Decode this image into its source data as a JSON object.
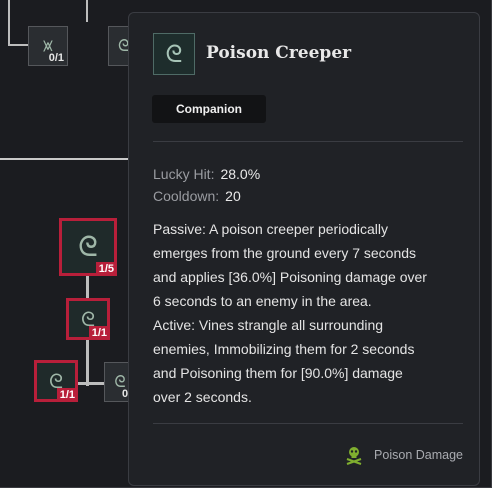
{
  "tooltip": {
    "title": "Poison Creeper",
    "icon": "vine-swirl-icon",
    "tag": "Companion",
    "stats": [
      {
        "label": "Lucky Hit:",
        "value": "28.0%"
      },
      {
        "label": "Cooldown:",
        "value": "20"
      }
    ],
    "description": [
      "Passive: A poison creeper periodically",
      "emerges from the ground every 7 seconds",
      "and applies [36.0%] Poisoning damage over",
      "6 seconds to an enemy in the area.",
      "Active: Vines strangle all surrounding",
      "enemies, Immobilizing them for 2 seconds",
      "and Poisoning them for [90.0%] damage",
      "over 2 seconds."
    ],
    "footer": {
      "icon": "skull-crossbones-icon",
      "label": "Poison Damage"
    }
  },
  "skill_tree": {
    "top_node": {
      "rank": "0/1",
      "icon": "claw-icon"
    },
    "main_node": {
      "rank": "1/5",
      "icon": "vine-swirl-icon"
    },
    "mid_node": {
      "rank": "1/1",
      "icon": "vine-swirl-icon"
    },
    "bottom_left_node": {
      "rank": "1/1",
      "icon": "vine-swirl-icon"
    },
    "bottom_right_node": {
      "rank": "0",
      "icon": "vine-swirl-icon"
    }
  },
  "colors": {
    "background": "#1b1c20",
    "tooltip_bg": "#202226",
    "active_border": "#b81f3a",
    "poison_green": "#7fae2f"
  }
}
